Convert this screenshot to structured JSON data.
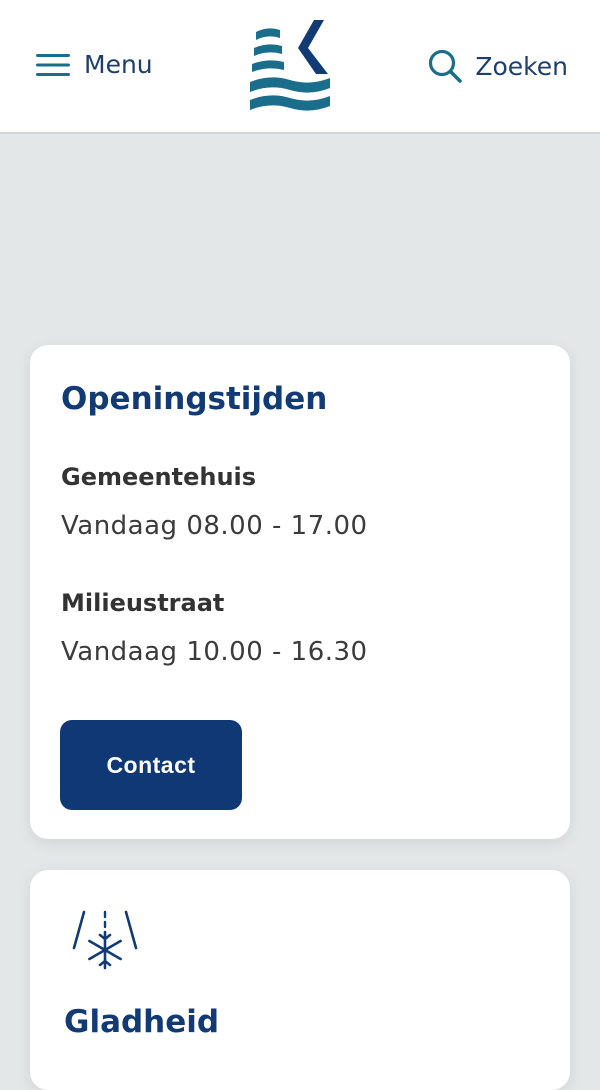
{
  "header": {
    "menu_label": "Menu",
    "search_label": "Zoeken"
  },
  "opening_hours": {
    "title": "Openingstijden",
    "locations": [
      {
        "name": "Gemeentehuis",
        "hours": "Vandaag 08.00 - 17.00"
      },
      {
        "name": "Milieustraat",
        "hours": "Vandaag 10.00 - 16.30"
      }
    ],
    "contact_label": "Contact"
  },
  "slipperiness": {
    "title": "Gladheid",
    "icon": "road-ice-icon"
  },
  "colors": {
    "brand_dark": "#0f3874",
    "brand_teal": "#1a6e8c",
    "background": "#e3e7e8"
  }
}
